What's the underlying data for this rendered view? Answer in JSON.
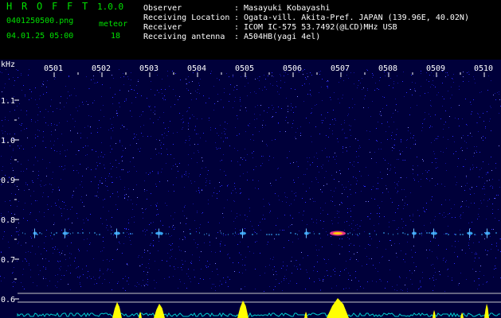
{
  "app": {
    "title_letters": [
      "H",
      "R",
      "O",
      "F",
      "F",
      "T"
    ],
    "version": "1.0.0"
  },
  "file": {
    "name": "0401250500.png",
    "datetime": "04.01.25 05:00"
  },
  "meteor": {
    "label": "meteor",
    "count": "18"
  },
  "info": [
    {
      "label": "Observer",
      "sep": ":",
      "value": "Masayuki Kobayashi"
    },
    {
      "label": "Receiving Location",
      "sep": ":",
      "value": "Ogata-vill. Akita-Pref. JAPAN (139.96E, 40.02N)"
    },
    {
      "label": "Receiver",
      "sep": ":",
      "value": "ICOM IC-575 53.7492(@LCD)MHz USB"
    },
    {
      "label": "Receiving antenna",
      "sep": ":",
      "value": "A504HB(yagi 4el)"
    }
  ],
  "spectrogram": {
    "unit": "kHz",
    "time_ticks": [
      "0501",
      "0502",
      "0503",
      "0504",
      "0505",
      "0506",
      "0507",
      "0508",
      "0509",
      "0510"
    ],
    "freq_ticks": [
      {
        "label": "1.1",
        "value": 1.1
      },
      {
        "label": "1.0",
        "value": 1.0
      },
      {
        "label": "0.9",
        "value": 0.9
      },
      {
        "label": "0.8",
        "value": 0.8
      },
      {
        "label": "0.7",
        "value": 0.7
      },
      {
        "label": "0.6",
        "value": 0.6
      }
    ],
    "colors": {
      "background": "#00003a",
      "noise": "#2a2aff",
      "signal_line": "#3ab0ff",
      "meteor_hot": "#ff3a8a",
      "meteor_warm": "#ffd000",
      "graph_fill": "#ffff00",
      "graph_line": "#00cccc",
      "tick_color": "#ffff00"
    }
  }
}
